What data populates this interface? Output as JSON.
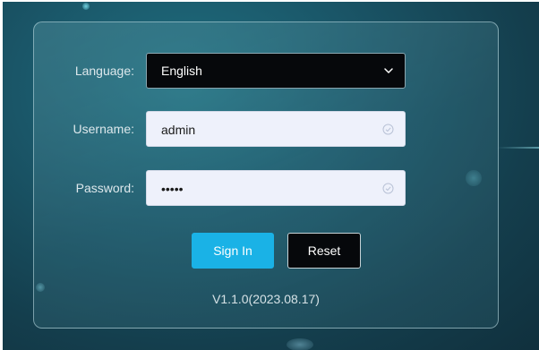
{
  "login": {
    "language_label": "Language:",
    "language_value": "English",
    "username_label": "Username:",
    "username_value": "admin",
    "password_label": "Password:",
    "password_value": "•••••",
    "sign_in_label": "Sign In",
    "reset_label": "Reset",
    "version": "V1.1.0(2023.08.17)"
  },
  "icons": {
    "language_dropdown": "chevron-down-icon",
    "username_status": "check-circle-icon",
    "password_status": "check-circle-icon"
  },
  "colors": {
    "background": "#1a5668",
    "primary_button": "#1ab2e6",
    "secondary_button": "#06080b",
    "select_background": "#06080b",
    "input_background": "#eef1fb"
  }
}
